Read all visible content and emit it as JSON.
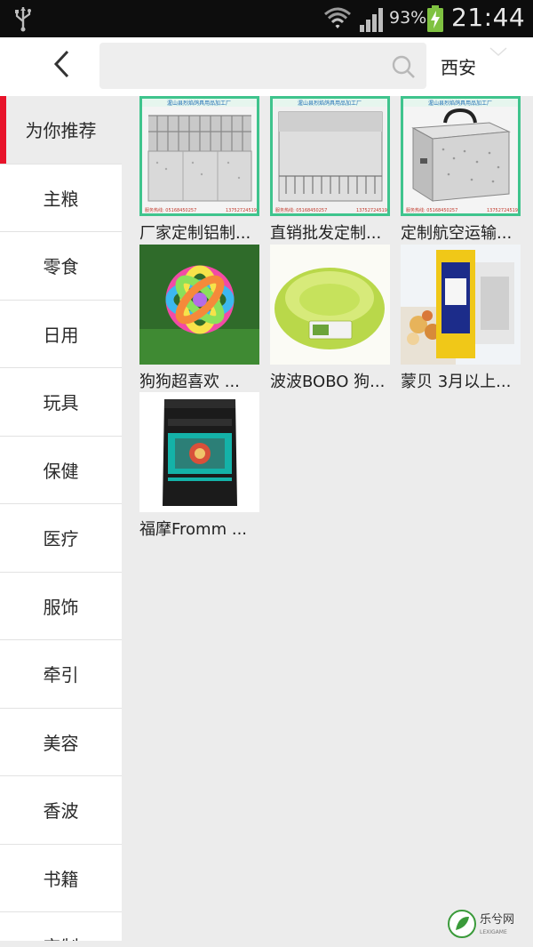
{
  "status_bar": {
    "battery_percent": "93%",
    "time": "21:44",
    "icons": [
      "usb-icon",
      "wifi-icon",
      "signal-icon",
      "battery-charging-icon"
    ]
  },
  "header": {
    "back_icon": "chevron-left-icon",
    "search": {
      "value": "",
      "placeholder": "",
      "icon": "search-icon"
    },
    "city": "西安"
  },
  "sidebar": {
    "active_index": 0,
    "accent_color": "#e8132a",
    "items": [
      {
        "label": "为你推荐"
      },
      {
        "label": "主粮"
      },
      {
        "label": "零食"
      },
      {
        "label": "日用"
      },
      {
        "label": "玩具"
      },
      {
        "label": "保健"
      },
      {
        "label": "医疗"
      },
      {
        "label": "服饰"
      },
      {
        "label": "牵引"
      },
      {
        "label": "美容"
      },
      {
        "label": "香波"
      },
      {
        "label": "书籍"
      },
      {
        "label": "定制"
      }
    ]
  },
  "products": [
    {
      "name": "厂家定制铝制...",
      "banner": "渥山县烈焰鸽具用品加工厂",
      "phone_left": "服务热线: 05168450257",
      "phone_right": "13752724519"
    },
    {
      "name": "直销批发定制...",
      "banner": "渥山县烈焰鸽具用品加工厂",
      "phone_left": "服务热线: 05168450257",
      "phone_right": "13752724519"
    },
    {
      "name": "定制航空运输...",
      "banner": "渥山县烈焰鸽具用品加工厂",
      "phone_left": "服务热线: 05168450257",
      "phone_right": "13752724519"
    },
    {
      "name": "狗狗超喜欢 ..."
    },
    {
      "name": "波波BOBO 狗..."
    },
    {
      "name": "蒙贝 3月以上..."
    },
    {
      "name": "福摩Fromm ..."
    }
  ],
  "watermark": {
    "text": "乐兮网",
    "subtext": "LEXIGAME"
  }
}
